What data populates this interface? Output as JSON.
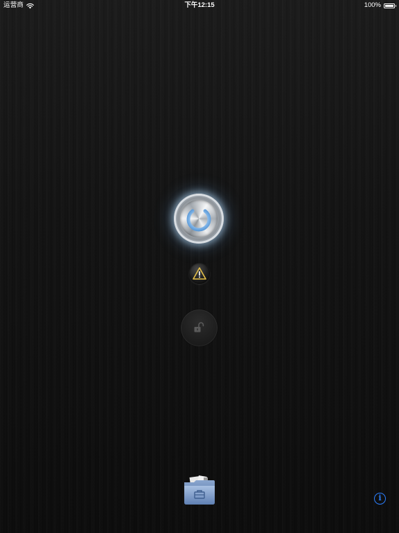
{
  "status_bar": {
    "carrier": "运营商",
    "time": "下午12:15",
    "battery_percent": "100%",
    "battery_level": 1.0
  },
  "controls": {
    "power_icon": "power-icon",
    "warning_icon": "warning-icon",
    "lock_icon": "unlocked-padlock-icon",
    "toolbox_icon": "toolbox-folder-icon",
    "info_label": "i"
  },
  "colors": {
    "power_glow": "#7fb8f0",
    "warning_yellow": "#e6c14a",
    "info_blue": "#2b7fff",
    "folder_blue": "#7a9ac8"
  }
}
